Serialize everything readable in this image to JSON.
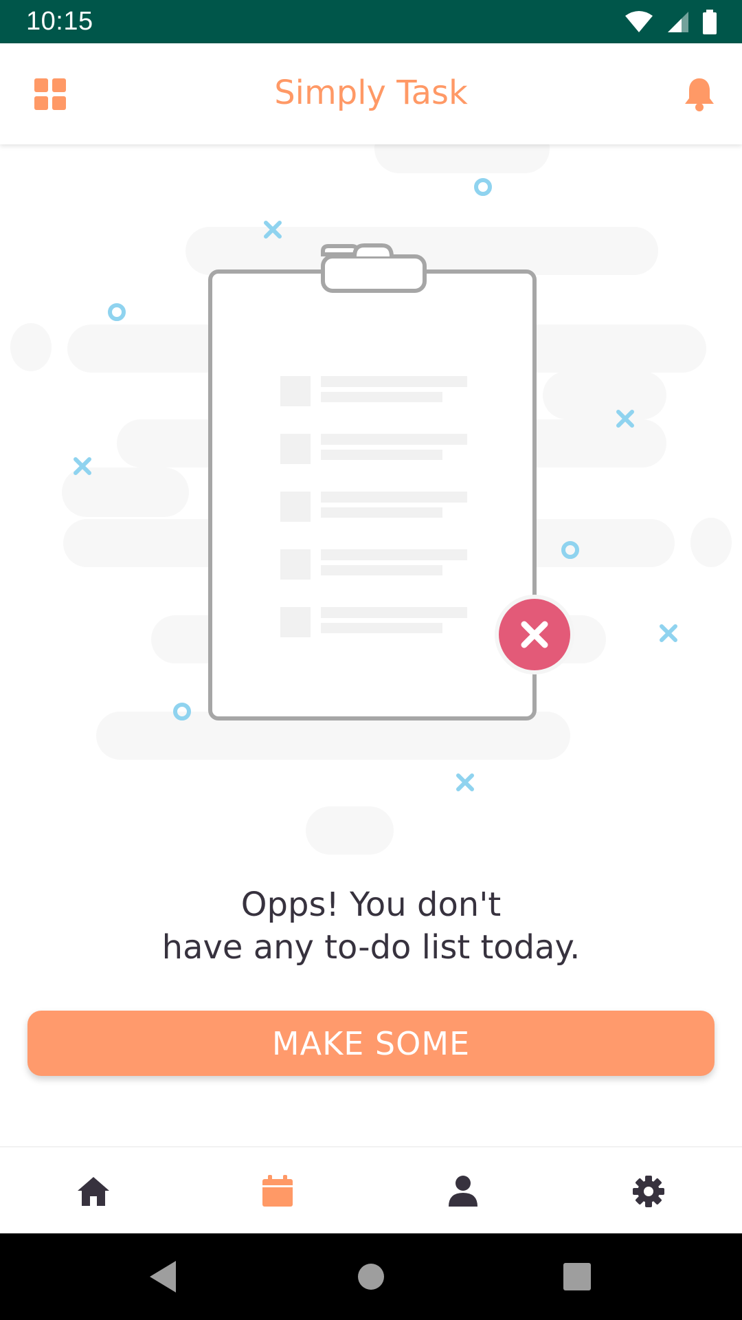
{
  "status_bar": {
    "time": "10:15",
    "icons": [
      "wifi-icon",
      "cell-signal-icon",
      "battery-icon"
    ],
    "background": "#00564a"
  },
  "app_bar": {
    "title": "Simply Task",
    "left_icon": "grid-menu-icon",
    "right_icon": "bell-icon",
    "accent": "#ff9966"
  },
  "empty_state": {
    "illustration": "empty-clipboard-illustration",
    "message_line1": "Opps! You don't",
    "message_line2": "have any to-do list today.",
    "text_color": "#37323e"
  },
  "cta": {
    "label": "MAKE SOME",
    "color": "#ff9a6c"
  },
  "bottom_nav": {
    "items": [
      {
        "icon": "home-icon",
        "active": false
      },
      {
        "icon": "calendar-icon",
        "active": true
      },
      {
        "icon": "person-icon",
        "active": false
      },
      {
        "icon": "gear-icon",
        "active": false
      }
    ],
    "active_color": "#ff9966",
    "inactive_color": "#37323e"
  },
  "system_nav": {
    "icons": [
      "back-icon",
      "home-circle-icon",
      "recents-icon"
    ]
  }
}
